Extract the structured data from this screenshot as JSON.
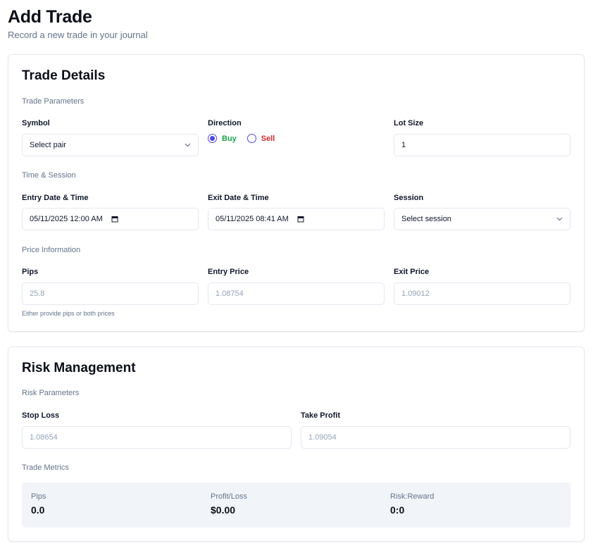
{
  "header": {
    "title": "Add Trade",
    "subtitle": "Record a new trade in your journal"
  },
  "trade_details": {
    "title": "Trade Details",
    "sections": {
      "parameters": "Trade Parameters",
      "time_session": "Time & Session",
      "price_info": "Price Information"
    },
    "symbol": {
      "label": "Symbol",
      "placeholder": "Select pair"
    },
    "direction": {
      "label": "Direction",
      "options": [
        "Buy",
        "Sell"
      ],
      "selected": "Buy",
      "colors": {
        "buy": "#16a34a",
        "sell": "#dc2626",
        "radio": "#4f46e5"
      }
    },
    "lot_size": {
      "label": "Lot Size",
      "value": "1"
    },
    "entry_datetime": {
      "label": "Entry Date & Time",
      "value": "05/11/2025 12:00  AM"
    },
    "exit_datetime": {
      "label": "Exit Date & Time",
      "value": "05/11/2025 08:41  AM"
    },
    "session": {
      "label": "Session",
      "placeholder": "Select session"
    },
    "pips": {
      "label": "Pips",
      "placeholder": "25.8"
    },
    "entry_price": {
      "label": "Entry Price",
      "placeholder": "1.08754"
    },
    "exit_price": {
      "label": "Exit Price",
      "placeholder": "1.09012"
    },
    "helper_text": "Either provide pips or both prices"
  },
  "risk_management": {
    "title": "Risk Management",
    "sections": {
      "parameters": "Risk Parameters",
      "metrics": "Trade Metrics"
    },
    "stop_loss": {
      "label": "Stop Loss",
      "placeholder": "1.08654"
    },
    "take_profit": {
      "label": "Take Profit",
      "placeholder": "1.09054"
    },
    "metrics": [
      {
        "label": "Pips",
        "value": "0.0"
      },
      {
        "label": "Profit/Loss",
        "value": "$0.00"
      },
      {
        "label": "Risk:Reward",
        "value": "0:0"
      }
    ]
  },
  "icons": {
    "select_chevron": "chevron-down-icon",
    "date_picker": "calendar-icon"
  }
}
